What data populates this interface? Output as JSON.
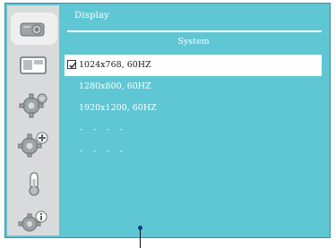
{
  "sidebar": {
    "items": [
      {
        "icon": "projector-icon",
        "active": true
      },
      {
        "icon": "screen-picture-icon",
        "active": false
      },
      {
        "icon": "gear-icon",
        "active": false
      },
      {
        "icon": "gear-plus-icon",
        "active": false
      },
      {
        "icon": "thermometer-icon",
        "active": false
      },
      {
        "icon": "info-gear-icon",
        "active": false
      }
    ]
  },
  "header": {
    "title": "Display"
  },
  "section": {
    "title": "System"
  },
  "list": {
    "items": [
      {
        "label": "1024x768, 60HZ",
        "selected": true
      },
      {
        "label": "1280x800, 60HZ",
        "selected": false
      },
      {
        "label": "1920x1200, 60HZ",
        "selected": false
      },
      {
        "label": "- - - -",
        "selected": false
      },
      {
        "label": "- - - -",
        "selected": false
      }
    ]
  },
  "colors": {
    "panel": "#5fc6d3",
    "sidebar": "#d8dadb",
    "selected_bg": "#ffffff",
    "text": "#ffffff"
  }
}
